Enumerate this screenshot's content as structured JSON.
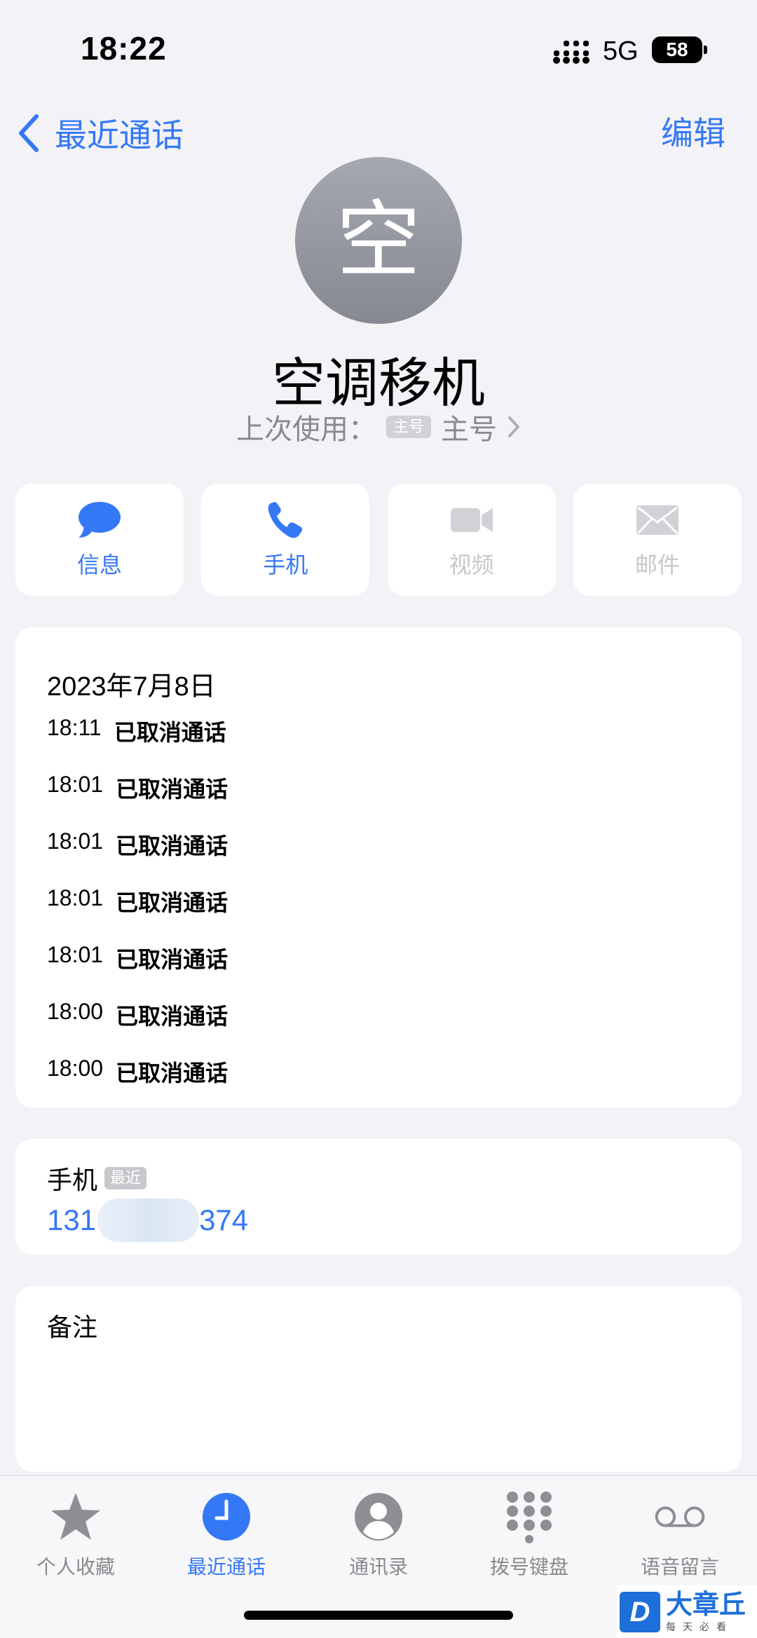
{
  "status": {
    "time": "18:22",
    "network": "5G",
    "battery": "58"
  },
  "nav": {
    "back_label": "最近通话",
    "edit_label": "编辑"
  },
  "contact": {
    "avatar_initial": "空",
    "name": "空调移机",
    "last_used_prefix": "上次使用：",
    "last_used_tag": "主号",
    "last_used_value": "主号"
  },
  "actions": [
    {
      "label": "信息",
      "icon": "message-icon",
      "enabled": true
    },
    {
      "label": "手机",
      "icon": "phone-icon",
      "enabled": true
    },
    {
      "label": "视频",
      "icon": "video-icon",
      "enabled": false
    },
    {
      "label": "邮件",
      "icon": "mail-icon",
      "enabled": false
    }
  ],
  "calls": {
    "date": "2023年7月8日",
    "rows": [
      {
        "time": "18:11",
        "status": "已取消通话"
      },
      {
        "time": "18:01",
        "status": "已取消通话"
      },
      {
        "time": "18:01",
        "status": "已取消通话"
      },
      {
        "time": "18:01",
        "status": "已取消通话"
      },
      {
        "time": "18:01",
        "status": "已取消通话"
      },
      {
        "time": "18:00",
        "status": "已取消通话"
      },
      {
        "time": "18:00",
        "status": "已取消通话"
      }
    ]
  },
  "phone": {
    "label": "手机",
    "badge": "最近",
    "number_prefix": "131",
    "number_suffix": "374"
  },
  "notes": {
    "label": "备注"
  },
  "tabs": [
    {
      "label": "个人收藏",
      "icon": "star-icon",
      "active": false
    },
    {
      "label": "最近通话",
      "icon": "clock-icon",
      "active": true
    },
    {
      "label": "通讯录",
      "icon": "person-icon",
      "active": false
    },
    {
      "label": "拨号键盘",
      "icon": "keypad-icon",
      "active": false
    },
    {
      "label": "语音留言",
      "icon": "voicemail-icon",
      "active": false
    }
  ],
  "watermark": {
    "logo": "D",
    "name": "大章丘",
    "sub": "每天必看"
  },
  "colors": {
    "accent": "#3478f6",
    "background": "#f2f2f7",
    "disabled": "#c7c7cc"
  }
}
